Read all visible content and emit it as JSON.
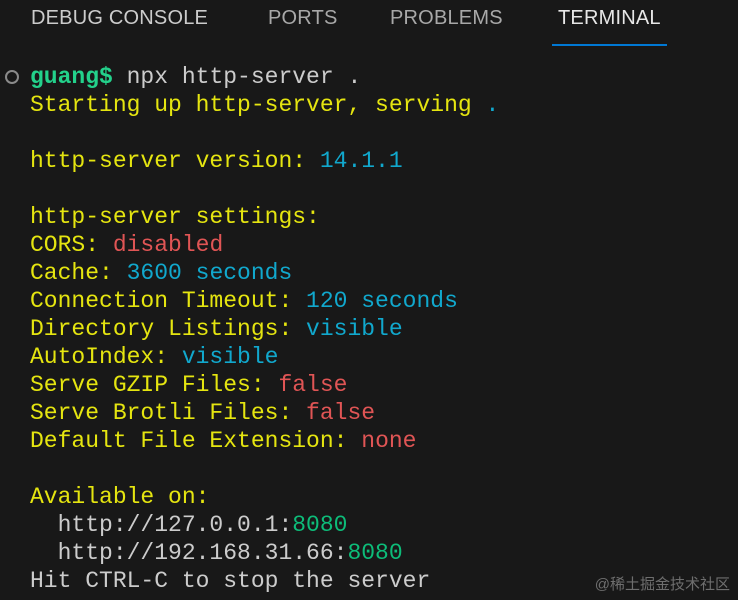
{
  "tabs": [
    {
      "label": "DEBUG CONSOLE",
      "active": false
    },
    {
      "label": "PORTS",
      "active": false
    },
    {
      "label": "PROBLEMS",
      "active": false
    },
    {
      "label": "TERMINAL",
      "active": true
    }
  ],
  "colors": {
    "prompt": "#23d18b",
    "default": "#cccccc",
    "yellow": "#e5e510",
    "cyan": "#11a8cd",
    "red": "#e05555",
    "green": "#0dbc79",
    "accent": "#0078d4"
  },
  "terminal": {
    "lines": [
      [
        {
          "text": "guang$",
          "c": "prompt",
          "bold": true
        },
        {
          "text": " npx http-server .",
          "c": "default"
        }
      ],
      [
        {
          "text": "Starting up http-server, serving ",
          "c": "yellow"
        },
        {
          "text": ".",
          "c": "cyan"
        }
      ],
      [],
      [
        {
          "text": "http-server version: ",
          "c": "yellow"
        },
        {
          "text": "14.1.1",
          "c": "cyan"
        }
      ],
      [],
      [
        {
          "text": "http-server settings: ",
          "c": "yellow"
        }
      ],
      [
        {
          "text": "CORS: ",
          "c": "yellow"
        },
        {
          "text": "disabled",
          "c": "red"
        }
      ],
      [
        {
          "text": "Cache: ",
          "c": "yellow"
        },
        {
          "text": "3600 seconds",
          "c": "cyan"
        }
      ],
      [
        {
          "text": "Connection Timeout: ",
          "c": "yellow"
        },
        {
          "text": "120 seconds",
          "c": "cyan"
        }
      ],
      [
        {
          "text": "Directory Listings: ",
          "c": "yellow"
        },
        {
          "text": "visible",
          "c": "cyan"
        }
      ],
      [
        {
          "text": "AutoIndex: ",
          "c": "yellow"
        },
        {
          "text": "visible",
          "c": "cyan"
        }
      ],
      [
        {
          "text": "Serve GZIP Files: ",
          "c": "yellow"
        },
        {
          "text": "false",
          "c": "red"
        }
      ],
      [
        {
          "text": "Serve Brotli Files: ",
          "c": "yellow"
        },
        {
          "text": "false",
          "c": "red"
        }
      ],
      [
        {
          "text": "Default File Extension: ",
          "c": "yellow"
        },
        {
          "text": "none",
          "c": "red"
        }
      ],
      [],
      [
        {
          "text": "Available on:",
          "c": "yellow"
        }
      ],
      [
        {
          "text": "  http://127.0.0.1:",
          "c": "default"
        },
        {
          "text": "8080",
          "c": "green"
        }
      ],
      [
        {
          "text": "  http://192.168.31.66:",
          "c": "default"
        },
        {
          "text": "8080",
          "c": "green"
        }
      ],
      [
        {
          "text": "Hit CTRL-C to stop the server",
          "c": "default"
        }
      ]
    ]
  },
  "watermark": "@稀土掘金技术社区"
}
